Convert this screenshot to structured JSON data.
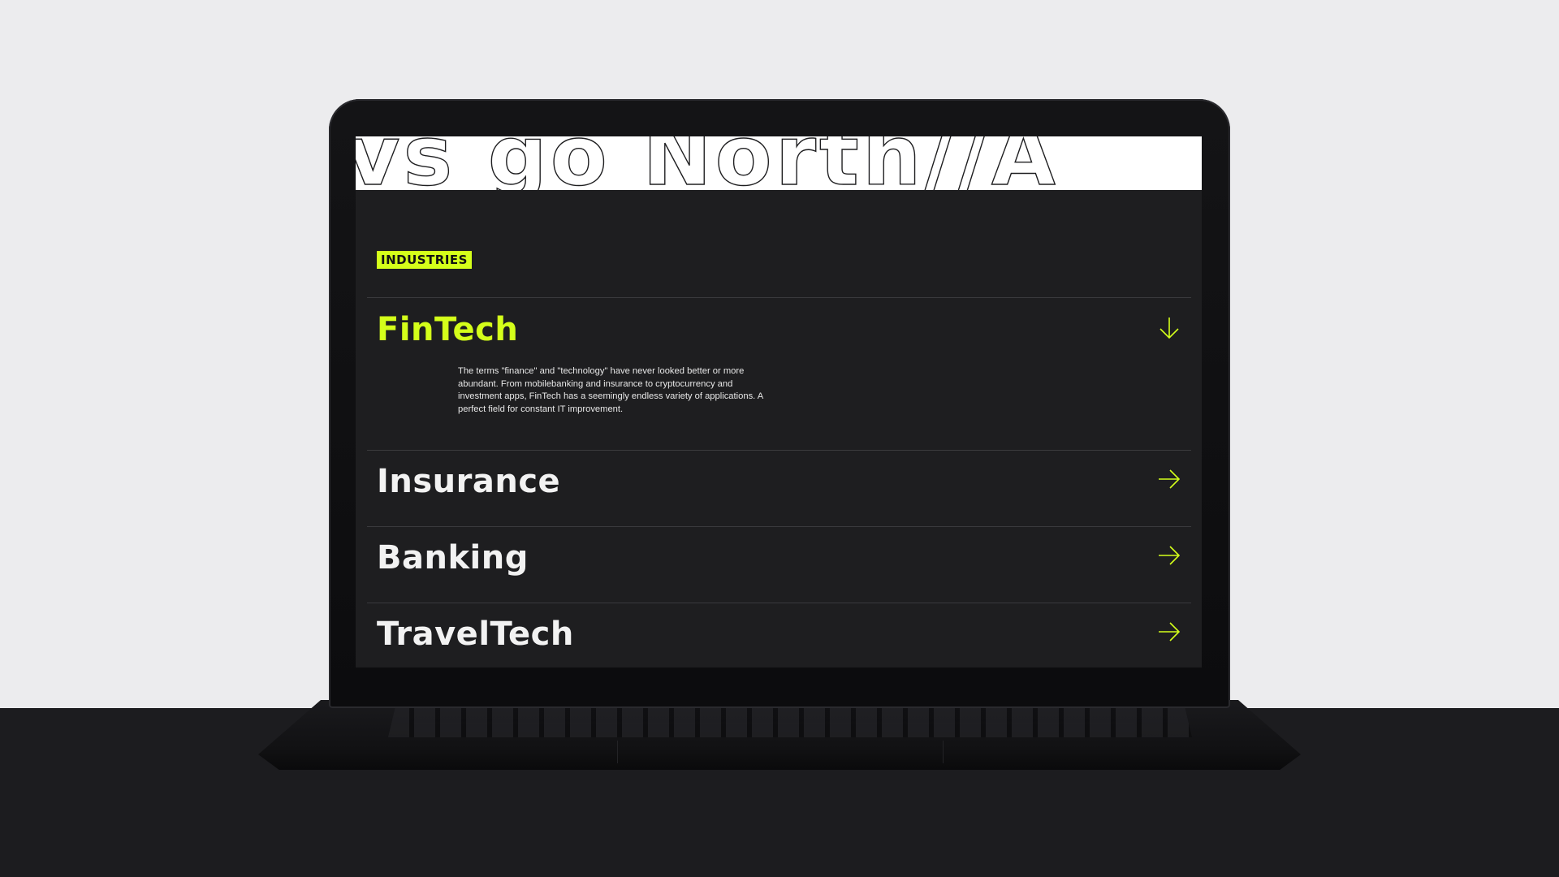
{
  "marquee": {
    "text": "vs go North//A"
  },
  "section": {
    "badge": "INDUSTRIES"
  },
  "industries": [
    {
      "title": "FinTech",
      "expanded": true,
      "icon": "arrow-down-icon",
      "description": "The terms \"finance\" and \"technology\" have never looked better or more abundant. From mobilebanking and insurance to cryptocurrency and investment apps, FinTech has a seemingly endless variety of applications. A perfect field for constant IT improvement."
    },
    {
      "title": "Insurance",
      "expanded": false,
      "icon": "arrow-right-icon"
    },
    {
      "title": "Banking",
      "expanded": false,
      "icon": "arrow-right-icon"
    },
    {
      "title": "TravelTech",
      "expanded": false,
      "icon": "arrow-right-icon"
    }
  ],
  "colors": {
    "accent": "#d4ff1a",
    "screen_background": "#1e1e20",
    "text": "#f2f2f2",
    "divider": "#3a3a3d"
  }
}
